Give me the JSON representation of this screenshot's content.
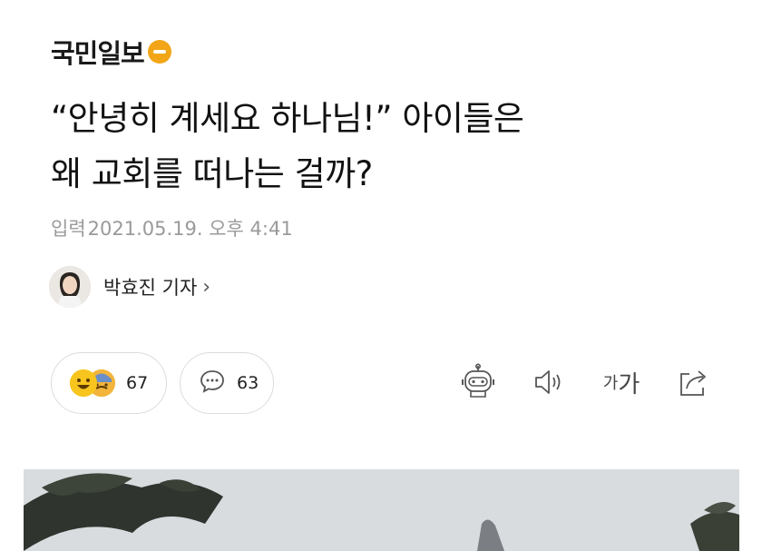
{
  "header": {
    "press_name": "국민일보"
  },
  "article": {
    "title_line1": "“안녕히 계세요 하나님!” 아이들은",
    "title_line2": "왜 교회를 떠나는 걸까?",
    "date_label": "입력",
    "date_value": "2021.05.19. 오후 4:41"
  },
  "reporter": {
    "name": "박효진 기자",
    "chevron": "›"
  },
  "reactions": {
    "count": "67",
    "icons": [
      "smile-emoji-icon",
      "sad-emoji-icon"
    ]
  },
  "comments": {
    "count": "63",
    "icon": "comment-bubble-icon"
  },
  "toolbar": {
    "items": [
      "robot-summary-icon",
      "speaker-icon",
      "font-size-icon",
      "share-icon"
    ],
    "font_small": "가",
    "font_large": "가"
  },
  "colors": {
    "brand": "#f2a516",
    "muted": "#9a9a9a",
    "border": "#dcdcdc"
  }
}
